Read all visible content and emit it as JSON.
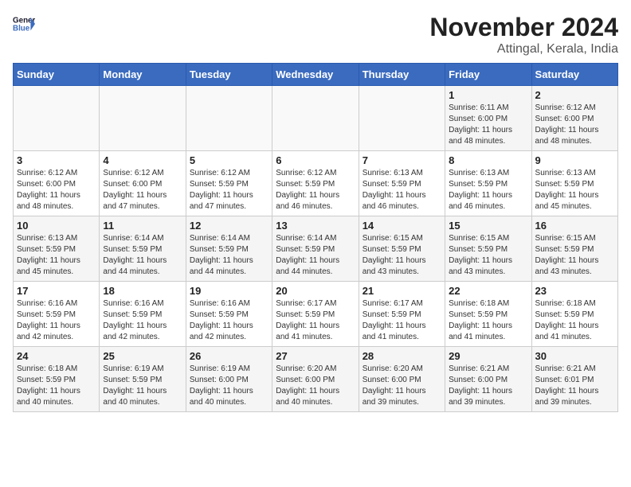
{
  "header": {
    "logo_general": "General",
    "logo_blue": "Blue",
    "title": "November 2024",
    "subtitle": "Attingal, Kerala, India"
  },
  "weekdays": [
    "Sunday",
    "Monday",
    "Tuesday",
    "Wednesday",
    "Thursday",
    "Friday",
    "Saturday"
  ],
  "weeks": [
    [
      {
        "day": "",
        "info": ""
      },
      {
        "day": "",
        "info": ""
      },
      {
        "day": "",
        "info": ""
      },
      {
        "day": "",
        "info": ""
      },
      {
        "day": "",
        "info": ""
      },
      {
        "day": "1",
        "info": "Sunrise: 6:11 AM\nSunset: 6:00 PM\nDaylight: 11 hours\nand 48 minutes."
      },
      {
        "day": "2",
        "info": "Sunrise: 6:12 AM\nSunset: 6:00 PM\nDaylight: 11 hours\nand 48 minutes."
      }
    ],
    [
      {
        "day": "3",
        "info": "Sunrise: 6:12 AM\nSunset: 6:00 PM\nDaylight: 11 hours\nand 48 minutes."
      },
      {
        "day": "4",
        "info": "Sunrise: 6:12 AM\nSunset: 6:00 PM\nDaylight: 11 hours\nand 47 minutes."
      },
      {
        "day": "5",
        "info": "Sunrise: 6:12 AM\nSunset: 5:59 PM\nDaylight: 11 hours\nand 47 minutes."
      },
      {
        "day": "6",
        "info": "Sunrise: 6:12 AM\nSunset: 5:59 PM\nDaylight: 11 hours\nand 46 minutes."
      },
      {
        "day": "7",
        "info": "Sunrise: 6:13 AM\nSunset: 5:59 PM\nDaylight: 11 hours\nand 46 minutes."
      },
      {
        "day": "8",
        "info": "Sunrise: 6:13 AM\nSunset: 5:59 PM\nDaylight: 11 hours\nand 46 minutes."
      },
      {
        "day": "9",
        "info": "Sunrise: 6:13 AM\nSunset: 5:59 PM\nDaylight: 11 hours\nand 45 minutes."
      }
    ],
    [
      {
        "day": "10",
        "info": "Sunrise: 6:13 AM\nSunset: 5:59 PM\nDaylight: 11 hours\nand 45 minutes."
      },
      {
        "day": "11",
        "info": "Sunrise: 6:14 AM\nSunset: 5:59 PM\nDaylight: 11 hours\nand 44 minutes."
      },
      {
        "day": "12",
        "info": "Sunrise: 6:14 AM\nSunset: 5:59 PM\nDaylight: 11 hours\nand 44 minutes."
      },
      {
        "day": "13",
        "info": "Sunrise: 6:14 AM\nSunset: 5:59 PM\nDaylight: 11 hours\nand 44 minutes."
      },
      {
        "day": "14",
        "info": "Sunrise: 6:15 AM\nSunset: 5:59 PM\nDaylight: 11 hours\nand 43 minutes."
      },
      {
        "day": "15",
        "info": "Sunrise: 6:15 AM\nSunset: 5:59 PM\nDaylight: 11 hours\nand 43 minutes."
      },
      {
        "day": "16",
        "info": "Sunrise: 6:15 AM\nSunset: 5:59 PM\nDaylight: 11 hours\nand 43 minutes."
      }
    ],
    [
      {
        "day": "17",
        "info": "Sunrise: 6:16 AM\nSunset: 5:59 PM\nDaylight: 11 hours\nand 42 minutes."
      },
      {
        "day": "18",
        "info": "Sunrise: 6:16 AM\nSunset: 5:59 PM\nDaylight: 11 hours\nand 42 minutes."
      },
      {
        "day": "19",
        "info": "Sunrise: 6:16 AM\nSunset: 5:59 PM\nDaylight: 11 hours\nand 42 minutes."
      },
      {
        "day": "20",
        "info": "Sunrise: 6:17 AM\nSunset: 5:59 PM\nDaylight: 11 hours\nand 41 minutes."
      },
      {
        "day": "21",
        "info": "Sunrise: 6:17 AM\nSunset: 5:59 PM\nDaylight: 11 hours\nand 41 minutes."
      },
      {
        "day": "22",
        "info": "Sunrise: 6:18 AM\nSunset: 5:59 PM\nDaylight: 11 hours\nand 41 minutes."
      },
      {
        "day": "23",
        "info": "Sunrise: 6:18 AM\nSunset: 5:59 PM\nDaylight: 11 hours\nand 41 minutes."
      }
    ],
    [
      {
        "day": "24",
        "info": "Sunrise: 6:18 AM\nSunset: 5:59 PM\nDaylight: 11 hours\nand 40 minutes."
      },
      {
        "day": "25",
        "info": "Sunrise: 6:19 AM\nSunset: 5:59 PM\nDaylight: 11 hours\nand 40 minutes."
      },
      {
        "day": "26",
        "info": "Sunrise: 6:19 AM\nSunset: 6:00 PM\nDaylight: 11 hours\nand 40 minutes."
      },
      {
        "day": "27",
        "info": "Sunrise: 6:20 AM\nSunset: 6:00 PM\nDaylight: 11 hours\nand 40 minutes."
      },
      {
        "day": "28",
        "info": "Sunrise: 6:20 AM\nSunset: 6:00 PM\nDaylight: 11 hours\nand 39 minutes."
      },
      {
        "day": "29",
        "info": "Sunrise: 6:21 AM\nSunset: 6:00 PM\nDaylight: 11 hours\nand 39 minutes."
      },
      {
        "day": "30",
        "info": "Sunrise: 6:21 AM\nSunset: 6:01 PM\nDaylight: 11 hours\nand 39 minutes."
      }
    ]
  ]
}
